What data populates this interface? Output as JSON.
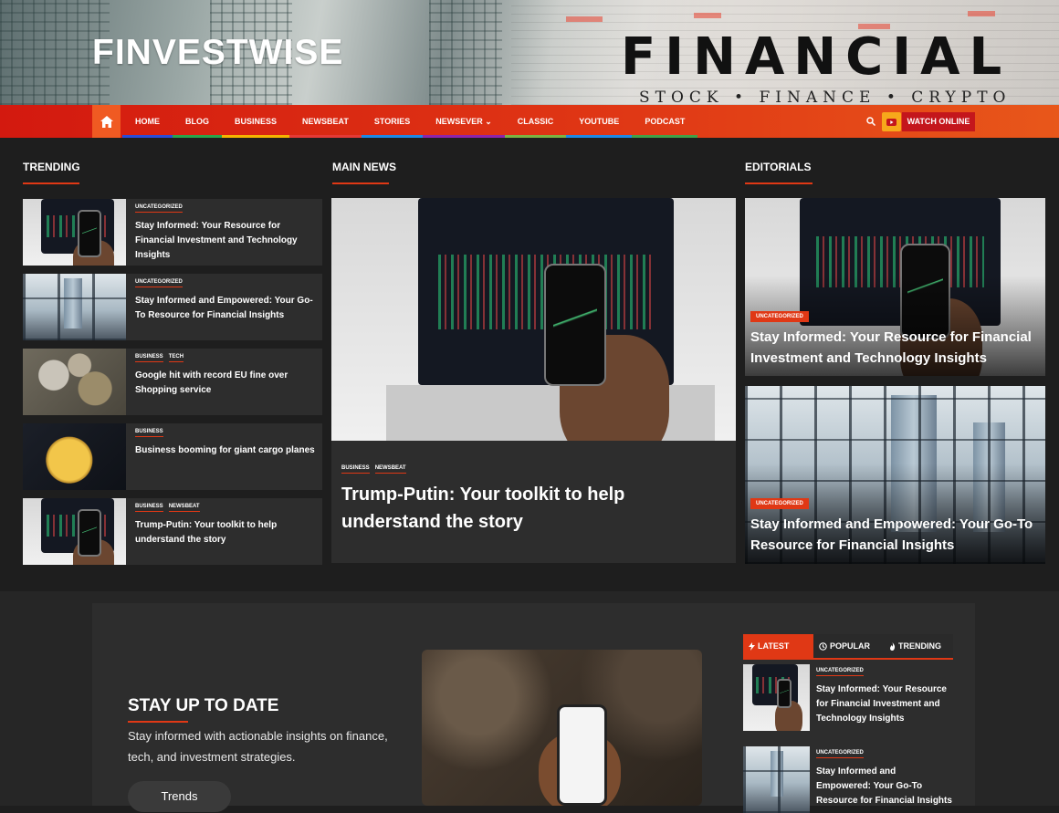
{
  "header": {
    "site_title": "FINVESTWISE",
    "banner_title": "FINANCIAL",
    "banner_subtitle": "STOCK • FINANCE • CRYPTO"
  },
  "nav": {
    "items": [
      {
        "label": "HOME",
        "underline": "#2b4bd8"
      },
      {
        "label": "BLOG",
        "underline": "#2aa44a"
      },
      {
        "label": "BUSINESS",
        "underline": "#f5b400"
      },
      {
        "label": "NEWSBEAT",
        "underline": "#e53935"
      },
      {
        "label": "STORIES",
        "underline": "#1e88e5"
      },
      {
        "label": "NEWSEVER",
        "underline": "#8e24aa"
      },
      {
        "label": "CLASSIC",
        "underline": "#7cb342"
      },
      {
        "label": "YOUTUBE",
        "underline": "#1e88e5"
      },
      {
        "label": "PODCAST",
        "underline": "#43a047"
      }
    ],
    "watch_label": "WATCH ONLINE"
  },
  "sections": {
    "trending": "TRENDING",
    "main_news": "MAIN NEWS",
    "editorials": "EDITORIALS"
  },
  "trending": [
    {
      "cats": [
        "UNCATEGORIZED"
      ],
      "title": "Stay Informed: Your Resource for Financial Investment and Technology Insights",
      "img": "laptop"
    },
    {
      "cats": [
        "UNCATEGORIZED"
      ],
      "title": "Stay Informed and Empowered: Your Go-To Resource for Financial Insights",
      "img": "city"
    },
    {
      "cats": [
        "BUSINESS",
        "TECH"
      ],
      "title": "Google hit with record EU fine over Shopping service",
      "img": "coins"
    },
    {
      "cats": [
        "BUSINESS"
      ],
      "title": "Business booming for giant cargo planes",
      "img": "gold"
    },
    {
      "cats": [
        "BUSINESS",
        "NEWSBEAT"
      ],
      "title": "Trump-Putin: Your toolkit to help understand the story",
      "img": "laptop"
    }
  ],
  "main_news": {
    "cats": [
      "BUSINESS",
      "NEWSBEAT"
    ],
    "title": "Trump-Putin: Your toolkit to help understand the story"
  },
  "editorials": [
    {
      "cat": "UNCATEGORIZED",
      "title": "Stay Informed: Your Resource for Financial Investment and Technology Insights"
    },
    {
      "cat": "UNCATEGORIZED",
      "title": "Stay Informed and Empowered: Your Go-To Resource for Financial Insights"
    }
  ],
  "promo": {
    "title": "STAY UP TO DATE",
    "text": "Stay informed with actionable insights on finance, tech, and investment strategies.",
    "button": "Trends"
  },
  "tabs": [
    {
      "label": "LATEST",
      "icon": "bolt-icon"
    },
    {
      "label": "POPULAR",
      "icon": "clock-icon"
    },
    {
      "label": "TRENDING",
      "icon": "fire-icon"
    }
  ],
  "latest": [
    {
      "cat": "UNCATEGORIZED",
      "title": "Stay Informed: Your Resource for Financial Investment and Technology Insights"
    },
    {
      "cat": "UNCATEGORIZED",
      "title": "Stay Informed and Empowered: Your Go-To Resource for Financial Insights"
    }
  ],
  "colors": {
    "accent": "#e03815",
    "nav_bg": "#d3190f",
    "watch_bg": "#c4161c",
    "youtube_bg": "#f7a81b"
  }
}
